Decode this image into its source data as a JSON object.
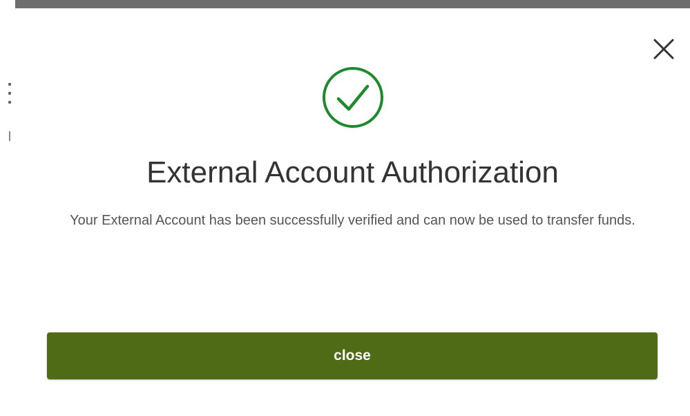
{
  "dialog": {
    "title": "External Account Authorization",
    "message": "Your External Account has been successfully verified and can now be used to transfer funds.",
    "close_button_label": "close"
  },
  "icons": {
    "close": "close-icon",
    "status": "checkmark-circle-icon"
  },
  "colors": {
    "success_green": "#1e8a2e",
    "button_green": "#4f6b15",
    "title_text": "#333333",
    "body_text": "#555555",
    "backdrop": "#6e6e6e"
  }
}
